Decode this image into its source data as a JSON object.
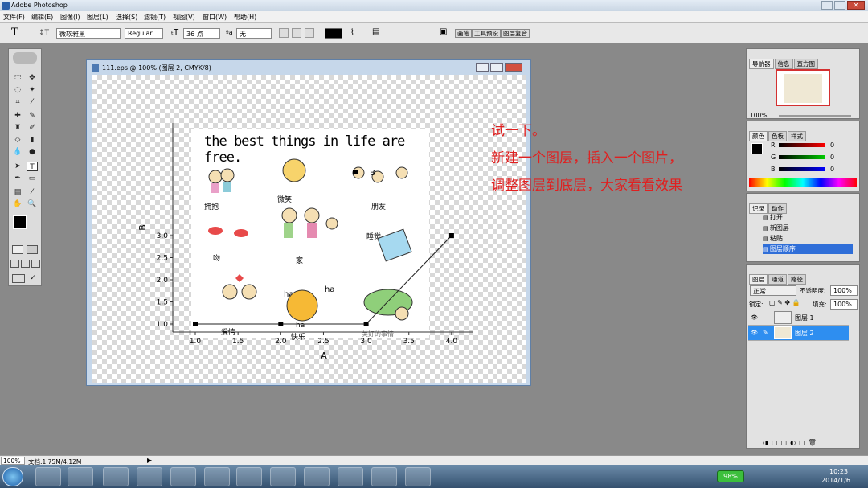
{
  "app": {
    "title": "Adobe Photoshop"
  },
  "menu": [
    "文件(F)",
    "编辑(E)",
    "图像(I)",
    "图层(L)",
    "选择(S)",
    "滤镜(T)",
    "视图(V)",
    "窗口(W)",
    "帮助(H)"
  ],
  "options": {
    "font_family": "微软雅黑",
    "font_style": "Regular",
    "font_size": "36 点",
    "antialias": "无",
    "tabs": [
      "画笔",
      "工具预设",
      "图层复合"
    ]
  },
  "document": {
    "title": "111.eps @ 100% (图层 2, CMYK/8)"
  },
  "chart_data": {
    "type": "line",
    "x": [
      1.0,
      2.0,
      3.0,
      4.0
    ],
    "y": [
      1.0,
      1.0,
      1.0,
      3.0
    ],
    "xlabel": "A",
    "ylabel": "B",
    "xlim": [
      0.75,
      4.25
    ],
    "ylim": [
      0.8,
      3.25
    ],
    "xticks": [
      "1.0",
      "1.5",
      "2.0",
      "2.5",
      "3.0",
      "3.5",
      "4.0"
    ],
    "yticks": [
      "1.0",
      "1.5",
      "2.0",
      "2.5",
      "3.0"
    ],
    "extra_point_label": "B",
    "grid": false
  },
  "image": {
    "heading": "the best things in life are free.",
    "labels": [
      "拥抱",
      "微笑",
      "朋友",
      "吻",
      "家",
      "睡觉",
      "爱情",
      "快乐"
    ],
    "ha1": "ha",
    "ha2": "ha",
    "ha3": "ha",
    "footer": "美好的事情"
  },
  "annotation": {
    "line1": "试一下。",
    "line2": "新建一个图层，插入一个图片，",
    "line3": "调整图层到底层，大家看看效果"
  },
  "navigator": {
    "tabs": [
      "导航器",
      "信息",
      "直方图"
    ],
    "zoom": "100%"
  },
  "color": {
    "tabs": [
      "颜色",
      "色板",
      "样式"
    ],
    "r_label": "R",
    "g_label": "G",
    "b_label": "B",
    "r": "0",
    "g": "0",
    "b": "0"
  },
  "history": {
    "tabs": [
      "记录",
      "动作"
    ],
    "items": [
      "打开",
      "新图层",
      "粘贴",
      "图层顺序"
    ]
  },
  "layers": {
    "tabs": [
      "图层",
      "通道",
      "路径"
    ],
    "mode": "正常",
    "opacity_label": "不透明度:",
    "opacity": "100%",
    "lock_label": "锁定:",
    "fill_label": "填充:",
    "fill": "100%",
    "items": [
      "图层 1",
      "图层 2"
    ]
  },
  "status": {
    "zoom": "100%",
    "doc": "文档:1.75M/4.12M"
  },
  "taskbar": {
    "battery": "98%",
    "time": "10:23",
    "date": "2014/1/6"
  }
}
